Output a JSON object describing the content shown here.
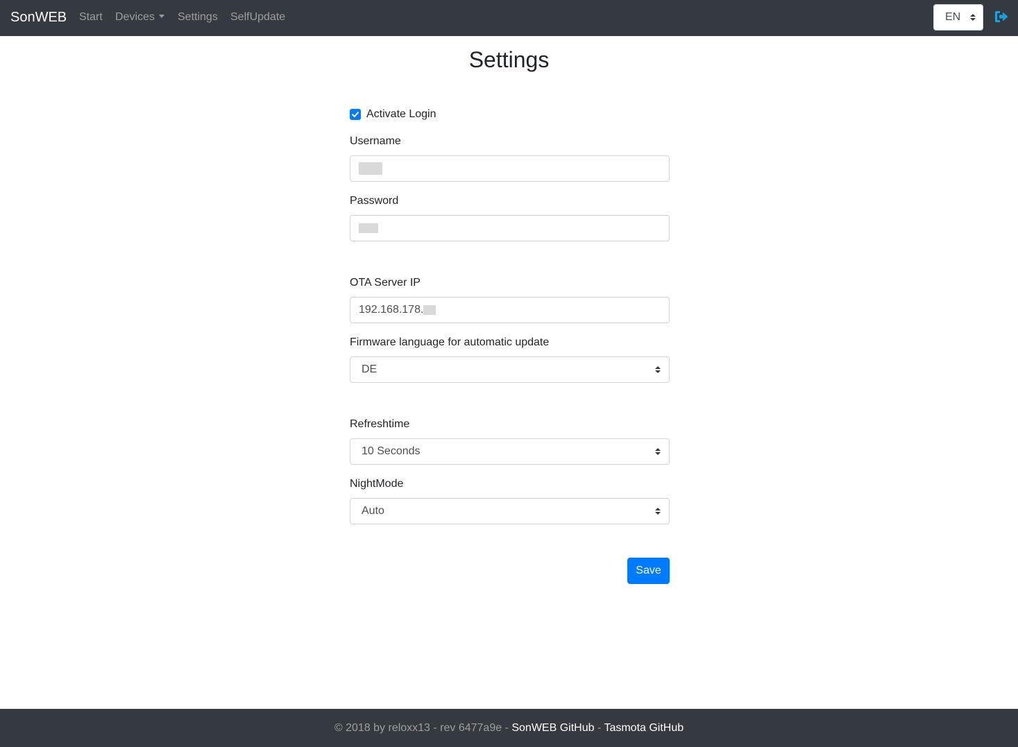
{
  "navbar": {
    "brand": "SonWEB",
    "links": {
      "start": "Start",
      "devices": "Devices",
      "settings": "Settings",
      "selfupdate": "SelfUpdate"
    },
    "language": "EN",
    "logout_icon": "sign-out-icon"
  },
  "page": {
    "title": "Settings"
  },
  "form": {
    "activate_login": {
      "label": "Activate Login",
      "checked": true
    },
    "username": {
      "label": "Username",
      "value": ""
    },
    "password": {
      "label": "Password",
      "value": ""
    },
    "ota_server_ip": {
      "label": "OTA Server IP",
      "value": "192.168.178."
    },
    "firmware_language": {
      "label": "Firmware language for automatic update",
      "value": "DE"
    },
    "refreshtime": {
      "label": "Refreshtime",
      "value": "10 Seconds"
    },
    "nightmode": {
      "label": "NightMode",
      "value": "Auto"
    },
    "save_label": "Save"
  },
  "footer": {
    "copyright": "© 2018 by reloxx13 - rev 6477a9e - ",
    "sonweb_link": "SonWEB GitHub",
    "separator": " - ",
    "tasmota_link": "Tasmota GitHub"
  },
  "colors": {
    "navbar_bg": "#343a40",
    "primary": "#007bff",
    "logout_icon": "#1e9fdf"
  }
}
